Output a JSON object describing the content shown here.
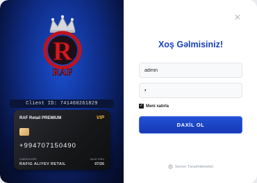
{
  "branding": {
    "logo_text": "RAF",
    "client_id": "Client ID: 741460261829"
  },
  "card": {
    "title": "RAF Retail PREMIUM",
    "tier": "VIP",
    "number": "+994707150490",
    "holder_label": "CARDHOLDER",
    "holder": "RAFIG ALIYEV RETAIL",
    "expiry_label": "VALID THRU",
    "expiry": "07/26"
  },
  "login": {
    "title": "Xoş Gəlmisiniz!",
    "username_value": "admin",
    "password_value": "•",
    "remember_label": "Məni xatırla",
    "remember_checked": true,
    "submit_label": "DAXİL OL",
    "server_settings_label": "Server Tənzimləmələri"
  },
  "colors": {
    "accent": "#1740b8",
    "card_tier": "#e7b736",
    "panel_dark": "#07123b"
  },
  "icons": {
    "close": "close-icon",
    "server": "gear-icon",
    "checkbox": "check-icon"
  }
}
